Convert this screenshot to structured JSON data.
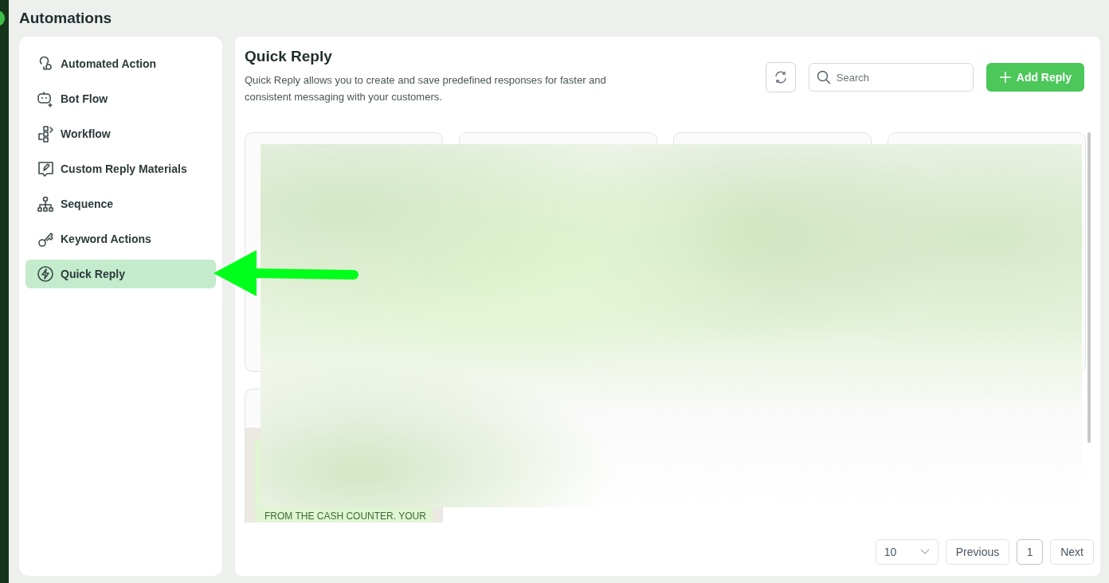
{
  "header": {
    "title": "Automations"
  },
  "sidebar": {
    "items": [
      {
        "label": "Automated Action",
        "selected": false
      },
      {
        "label": "Bot Flow",
        "selected": false
      },
      {
        "label": "Workflow",
        "selected": false
      },
      {
        "label": "Custom Reply Materials",
        "selected": false
      },
      {
        "label": "Sequence",
        "selected": false
      },
      {
        "label": "Keyword Actions",
        "selected": false
      },
      {
        "label": "Quick Reply",
        "selected": true
      }
    ]
  },
  "panel": {
    "title": "Quick Reply",
    "description": "Quick Reply allows you to create and save predefined responses for faster and consistent messaging with your customers.",
    "search": {
      "placeholder": "Search"
    },
    "add_button": "Add Reply",
    "cards": [
      {
        "kind": "reply"
      },
      {
        "kind": "reply"
      },
      {
        "kind": "reply"
      },
      {
        "kind": "reply"
      },
      {
        "kind": "reply",
        "message": "FROM THE CASH COUNTER. YOUR"
      }
    ],
    "pagination": {
      "page_size": "10",
      "previous": "Previous",
      "pages": [
        {
          "label": "1",
          "selected": true
        }
      ],
      "next": "Next"
    }
  }
}
